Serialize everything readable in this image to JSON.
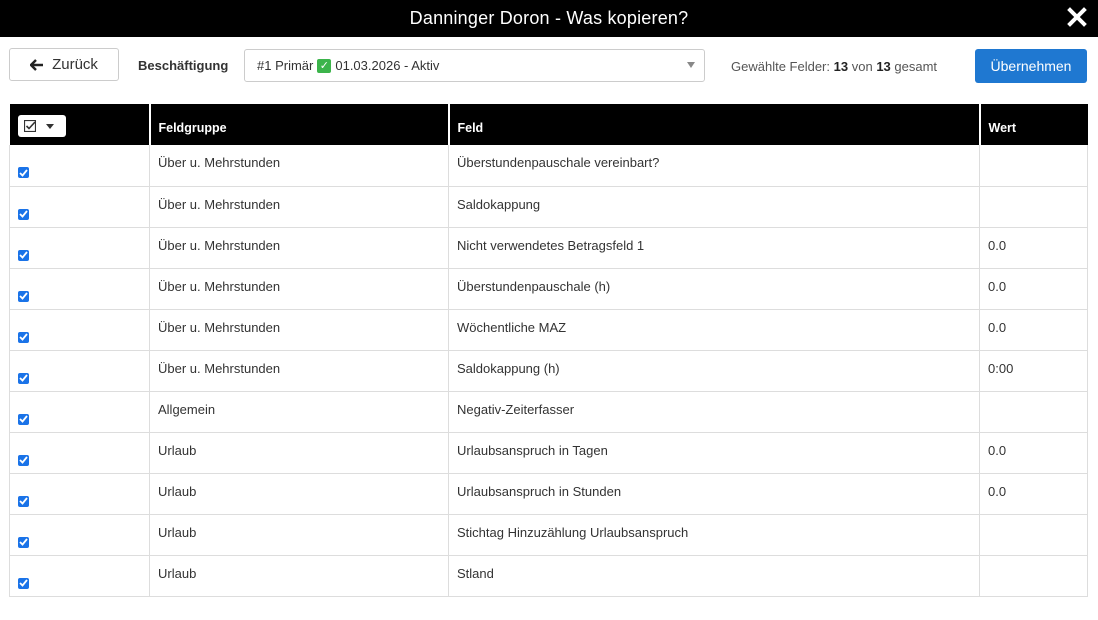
{
  "titlebar": {
    "title": "Danninger Doron - Was kopieren?",
    "close_icon": "close-icon"
  },
  "toolbar": {
    "back_label": "Zurück",
    "employment_label": "Beschäftigung",
    "employment_select": {
      "prefix": "#1 Primär",
      "status_icon": "check-mark-emoji",
      "suffix": "01.03.2026 - Aktiv"
    },
    "selected_prefix": "Gewählte Felder:",
    "selected_count": "13",
    "selected_of": "von",
    "selected_total": "13",
    "selected_suffix": "gesamt",
    "apply_label": "Übernehmen",
    "apply_color": "#1f78d1"
  },
  "table": {
    "headers": {
      "group": "Feldgruppe",
      "field": "Feld",
      "value": "Wert"
    },
    "rows": [
      {
        "checked": true,
        "group": "Über u. Mehrstunden",
        "field": "Überstundenpauschale vereinbart?",
        "value": ""
      },
      {
        "checked": true,
        "group": "Über u. Mehrstunden",
        "field": "Saldokappung",
        "value": ""
      },
      {
        "checked": true,
        "group": "Über u. Mehrstunden",
        "field": "Nicht verwendetes Betragsfeld 1",
        "value": "0.0"
      },
      {
        "checked": true,
        "group": "Über u. Mehrstunden",
        "field": "Überstundenpauschale (h)",
        "value": "0.0"
      },
      {
        "checked": true,
        "group": "Über u. Mehrstunden",
        "field": "Wöchentliche MAZ",
        "value": "0.0"
      },
      {
        "checked": true,
        "group": "Über u. Mehrstunden",
        "field": "Saldokappung (h)",
        "value": "0:00"
      },
      {
        "checked": true,
        "group": "Allgemein",
        "field": "Negativ-Zeiterfasser",
        "value": ""
      },
      {
        "checked": true,
        "group": "Urlaub",
        "field": "Urlaubsanspruch in Tagen",
        "value": "0.0"
      },
      {
        "checked": true,
        "group": "Urlaub",
        "field": "Urlaubsanspruch in Stunden",
        "value": "0.0"
      },
      {
        "checked": true,
        "group": "Urlaub",
        "field": "Stichtag Hinzuzählung Urlaubsanspruch",
        "value": ""
      },
      {
        "checked": true,
        "group": "Urlaub",
        "field": "Stland",
        "value": ""
      }
    ]
  }
}
